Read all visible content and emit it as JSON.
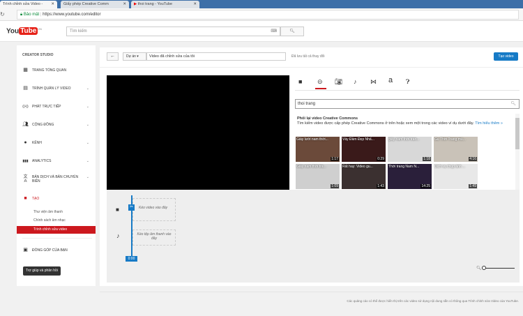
{
  "browser": {
    "tabs": [
      {
        "title": "Trình chỉnh sửa Video - "
      },
      {
        "title": "Giấy phép Creative Comm"
      },
      {
        "title": "thoi trang - YouTube"
      }
    ],
    "secure_label": "Bảo mật",
    "url": "https://www.youtube.com/editor"
  },
  "header": {
    "logo_you": "You",
    "logo_tube": "Tube",
    "region": "VN",
    "search_placeholder": "Tìm kiếm"
  },
  "sidebar": {
    "title": "CREATOR STUDIO",
    "items": [
      {
        "label": "TRANG TỔNG QUAN",
        "icon": "▦"
      },
      {
        "label": "TRÌNH QUẢN LÝ VIDEO",
        "icon": "▤"
      },
      {
        "label": "PHÁT TRỰC TIẾP",
        "icon": "((•))"
      },
      {
        "label": "CỘNG ĐỒNG",
        "icon": "👥"
      },
      {
        "label": "KÊNH",
        "icon": "●"
      },
      {
        "label": "ANALYTICS",
        "icon": "▮▮▮"
      },
      {
        "label": "BẢN DỊCH VÀ BẢN CHUYỂN BIÊN",
        "icon": "文A"
      },
      {
        "label": "TẠO",
        "icon": "■"
      }
    ],
    "sub_items": [
      "Thư viện âm thanh",
      "Chính sách âm nhạc",
      "Trình chỉnh sửa video"
    ],
    "contrib": "ĐÓNG GÓP CỦA BẠN",
    "help_button": "Trợ giúp và phản hồi"
  },
  "toolbar": {
    "back": "←",
    "project": "Dự án ▾",
    "project_name": "Video đã chỉnh sửa của tôi",
    "saved": "Đã lưu tất cả thay đổi",
    "create": "Tạo video"
  },
  "panel": {
    "search_value": "thoi trang",
    "heading": "Phối lại video Creative Commons",
    "desc": "Tìm kiếm video được cấp phép Creative Commons ở trên hoặc xem một trong các video ví dụ dưới đây.",
    "learn_more": "Tìm hiểu thêm »",
    "videos": [
      {
        "title": "Giày lười nam thời...",
        "duration": "1:17",
        "color": "#6b4a3a"
      },
      {
        "title": "Váy Đầm Đẹp Nhấ...",
        "duration": "0:29",
        "color": "#3a1a1a"
      },
      {
        "title": "giày nam thời tran...",
        "duration": "1:18",
        "color": "#d8d8d8"
      },
      {
        "title": "Gu Thời Trang mù...",
        "duration": "4:16",
        "color": "#c9c2b8"
      },
      {
        "title": "Giày nam thời tra...",
        "duration": "1:09",
        "color": "#cfcfcf"
      },
      {
        "title": "Rất hay: Video gu...",
        "duration": "1:43",
        "color": "#3b3030"
      },
      {
        "title": "Thời trang Nam N...",
        "duration": "14:25",
        "color": "#2a1f3a"
      },
      {
        "title": "Dịch vụ chụp ảnh ...",
        "duration": "1:49",
        "color": "#e8e8e8"
      }
    ]
  },
  "timeline": {
    "video_drop": "Kéo video vào đây",
    "audio_drop": "Kéo tệp âm thanh vào đây",
    "time": "0:00"
  },
  "footer": {
    "text": "Các quảng cáo có thể được hiển thị trên các video sử dụng nội dung sẵn có thông qua Trình chỉnh sửa Video của YouTube."
  },
  "colors": {
    "accent": "#cc181e",
    "blue": "#167ac6"
  }
}
